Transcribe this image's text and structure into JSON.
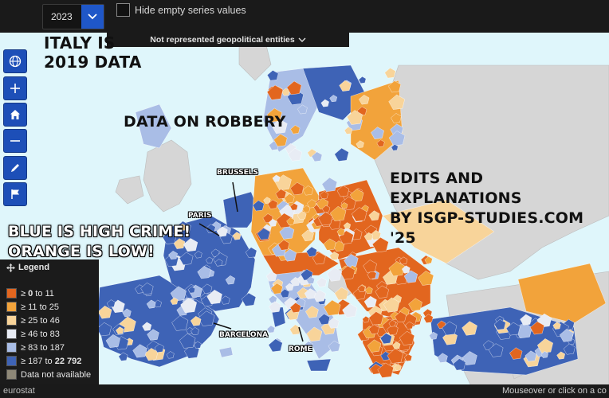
{
  "controls": {
    "year": "2023",
    "hide_empty_label": "Hide empty series values",
    "geo_entities_label": "Not represented geopolitical entities"
  },
  "toolbar": {
    "tools": [
      "globe-icon",
      "zoom-in-icon",
      "home-icon",
      "zoom-out-icon",
      "pencil-icon",
      "flag-icon"
    ]
  },
  "annotations": {
    "italy": "ITALY IS\n2019 DATA",
    "robbery": "DATA ON ROBBERY",
    "edits": "EDITS AND EXPLANATIONS\nBY ISGP-STUDIES.COM '25",
    "blue_orange": "BLUE IS HIGH CRIME!\nORANGE IS LOW!"
  },
  "cities": {
    "brussels": "BRUSSELS",
    "paris": "PARIS",
    "barcelona": "BARCELONA",
    "rome": "ROME"
  },
  "legend": {
    "title": "Legend",
    "items": [
      {
        "label_pre": "≥ ",
        "label_bold": "0",
        "label_post": " to 11",
        "color": "#e2661f"
      },
      {
        "label_pre": "≥ 11 to 25",
        "label_bold": "",
        "label_post": "",
        "color": "#f2a33b"
      },
      {
        "label_pre": "≥ 25 to 46",
        "label_bold": "",
        "label_post": "",
        "color": "#f8d49a"
      },
      {
        "label_pre": "≥ 46 to 83",
        "label_bold": "",
        "label_post": "",
        "color": "#e8ecf4"
      },
      {
        "label_pre": "≥ 83 to 187",
        "label_bold": "",
        "label_post": "",
        "color": "#a9bde6"
      },
      {
        "label_pre": "≥ 187 to ",
        "label_bold": "22 792",
        "label_post": "",
        "color": "#3e63b6"
      },
      {
        "label_pre": "Data not available",
        "label_bold": "",
        "label_post": "",
        "color": "#8e8878"
      }
    ]
  },
  "footer": {
    "brand": "eurostat",
    "hint": "Mouseover or click on a co"
  },
  "colors": {
    "sea": "#dff6fb",
    "non_eu_land": "#d4d4d4",
    "high": "#3e63b6",
    "low": "#e2661f"
  }
}
